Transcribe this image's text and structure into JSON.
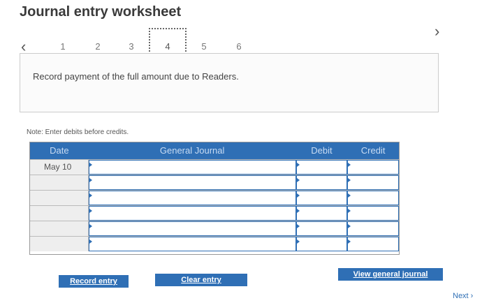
{
  "title": "Journal entry worksheet",
  "nav": {
    "prev_icon": "‹",
    "next_icon": "›",
    "steps": [
      "1",
      "2",
      "3",
      "4",
      "5",
      "6"
    ],
    "active_step": "4"
  },
  "prompt": "Record payment of the full amount due to Readers.",
  "note": "Note: Enter debits before credits.",
  "journal": {
    "headers": {
      "date": "Date",
      "account": "General Journal",
      "debit": "Debit",
      "credit": "Credit"
    },
    "rows": [
      {
        "date": "May 10",
        "account": "",
        "debit": "",
        "credit": ""
      },
      {
        "date": "",
        "account": "",
        "debit": "",
        "credit": ""
      },
      {
        "date": "",
        "account": "",
        "debit": "",
        "credit": ""
      },
      {
        "date": "",
        "account": "",
        "debit": "",
        "credit": ""
      },
      {
        "date": "",
        "account": "",
        "debit": "",
        "credit": ""
      },
      {
        "date": "",
        "account": "",
        "debit": "",
        "credit": ""
      }
    ]
  },
  "buttons": {
    "record": "Record entry",
    "clear": "Clear entry",
    "view": "View general journal"
  },
  "next_label": "Next ›"
}
